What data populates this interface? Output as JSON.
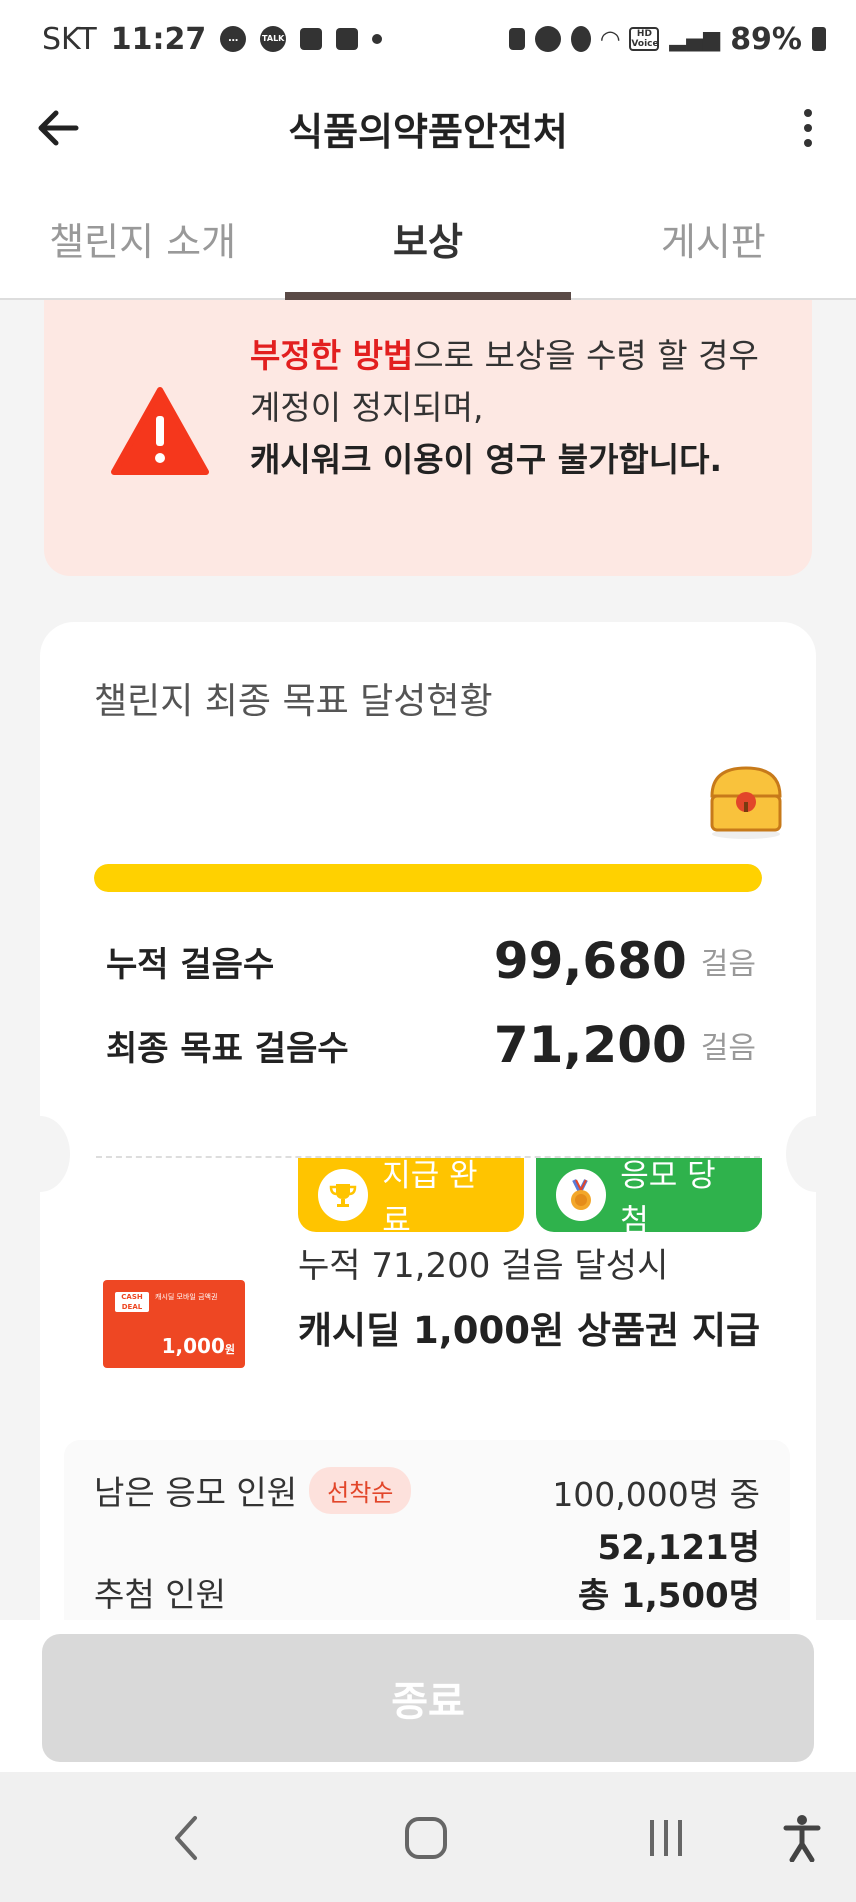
{
  "status_bar": {
    "carrier": "SKT",
    "time": "11:27",
    "talk_label": "TALK",
    "battery": "89%",
    "hd_voice_label": "HD Voice"
  },
  "app_bar": {
    "title": "식품의약품안전처"
  },
  "tabs": [
    {
      "label": "챌린지 소개",
      "active": false
    },
    {
      "label": "보상",
      "active": true
    },
    {
      "label": "게시판",
      "active": false
    }
  ],
  "warning": {
    "red_text": "부정한 방법",
    "text_after_red": "으로 보상을 수령 할 경우",
    "line2": "계정이 정지되며,",
    "bold_line": "캐시워크 이용이 영구 불가합니다."
  },
  "goal_card": {
    "title": "챌린지 최종 목표 달성현황",
    "progress_fraction": 1.0,
    "accumulated_label": "누적 걸음수",
    "accumulated_value": "99,680",
    "final_goal_label": "최종 목표 걸음수",
    "final_goal_value": "71,200",
    "unit": "걸음"
  },
  "reward": {
    "badge_complete": "지급 완료",
    "badge_won": "응모 당첨",
    "condition": "누적 71,200 걸음 달성시",
    "title": "캐시딜 1,000원 상품권 지급",
    "giftcard_logo": "CASH DEAL",
    "giftcard_caption": "캐시딜 모바일 금액권",
    "giftcard_amount": "1,000",
    "giftcard_currency": "원"
  },
  "info": {
    "remaining_label": "남은 응모 인원",
    "first_come_pill": "선착순",
    "remaining_total": "100,000명 중",
    "remaining_count": "52,121명",
    "draw_label": "추첨 인원",
    "draw_count": "총 1,500명"
  },
  "bottom": {
    "end_button": "종료"
  },
  "colors": {
    "accent_yellow": "#ffd100",
    "warning_red": "#e21f1f",
    "badge_green": "#2fb24c",
    "badge_yellow": "#ffc400"
  }
}
